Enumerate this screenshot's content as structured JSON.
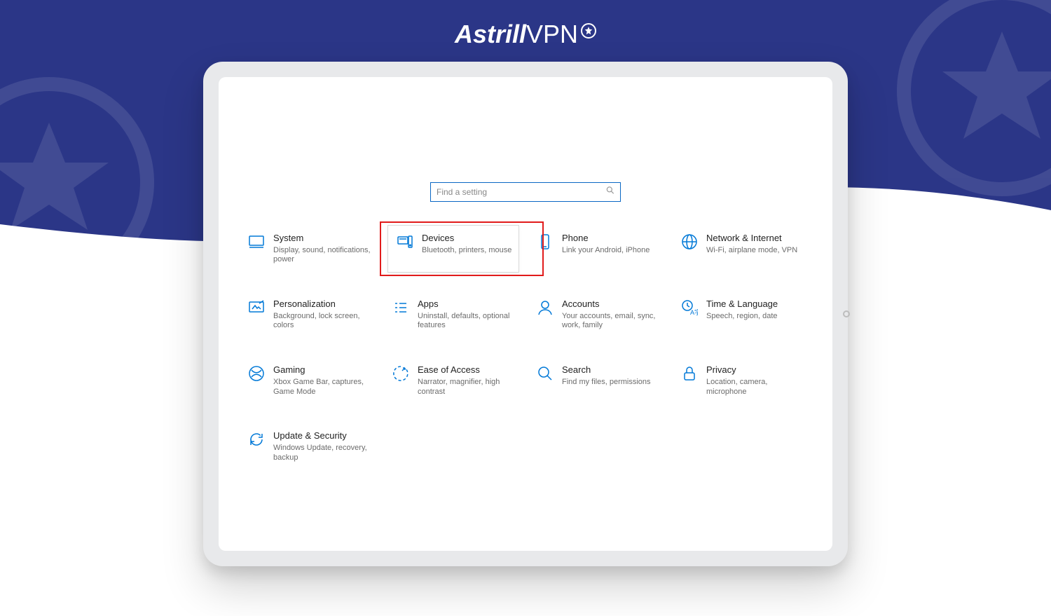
{
  "brand": {
    "name_bold": "Astrill",
    "name_thin": "VPN"
  },
  "search": {
    "placeholder": "Find a setting"
  },
  "tiles": {
    "system": {
      "title": "System",
      "sub": "Display, sound, notifications, power"
    },
    "devices": {
      "title": "Devices",
      "sub": "Bluetooth, printers, mouse"
    },
    "phone": {
      "title": "Phone",
      "sub": "Link your Android, iPhone"
    },
    "network": {
      "title": "Network & Internet",
      "sub": "Wi-Fi, airplane mode, VPN"
    },
    "personalization": {
      "title": "Personalization",
      "sub": "Background, lock screen, colors"
    },
    "apps": {
      "title": "Apps",
      "sub": "Uninstall, defaults, optional features"
    },
    "accounts": {
      "title": "Accounts",
      "sub": "Your accounts, email, sync, work, family"
    },
    "time": {
      "title": "Time & Language",
      "sub": "Speech, region, date"
    },
    "gaming": {
      "title": "Gaming",
      "sub": "Xbox Game Bar, captures, Game Mode"
    },
    "ease": {
      "title": "Ease of Access",
      "sub": "Narrator, magnifier, high contrast"
    },
    "search": {
      "title": "Search",
      "sub": "Find my files, permissions"
    },
    "privacy": {
      "title": "Privacy",
      "sub": "Location, camera, microphone"
    },
    "update": {
      "title": "Update & Security",
      "sub": "Windows Update, recovery, backup"
    }
  }
}
